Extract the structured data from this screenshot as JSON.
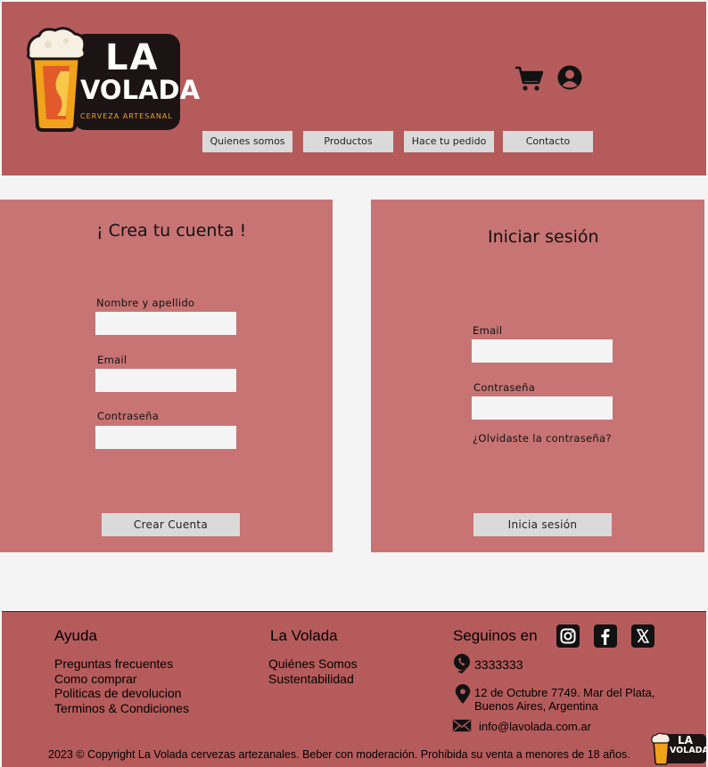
{
  "header": {
    "logo": {
      "line1": "LA",
      "line2": "VOLADA",
      "tagline": "CERVEZA ARTESANAL"
    },
    "icons": [
      "cart-icon",
      "user-icon"
    ],
    "nav": [
      {
        "label": "Quienes somos"
      },
      {
        "label": "Productos"
      },
      {
        "label": "Hace tu pedido"
      },
      {
        "label": "Contacto"
      }
    ]
  },
  "register": {
    "title": "¡ Crea tu cuenta !",
    "name_label": "Nombre y apellido",
    "name_value": "",
    "email_label": "Email",
    "email_value": "",
    "password_label": "Contraseña",
    "password_value": "",
    "submit_label": "Crear Cuenta"
  },
  "login": {
    "title": "Iniciar sesión",
    "email_label": "Email",
    "email_value": "",
    "password_label": "Contraseña",
    "password_value": "",
    "forgot_label": "¿Olvidaste la contraseña?",
    "submit_label": "Inicia sesión"
  },
  "footer": {
    "help": {
      "heading": "Ayuda",
      "links": [
        "Preguntas frecuentes",
        "Como comprar",
        "Politicas de devolucion",
        "Terminos & Condiciones"
      ]
    },
    "about": {
      "heading": "La Volada",
      "links": [
        "Quiénes Somos",
        "Sustentabilidad"
      ]
    },
    "contact": {
      "heading": "Seguinos en",
      "social": [
        "instagram-icon",
        "facebook-icon",
        "x-icon"
      ],
      "phone": "3333333",
      "address": "12 de Octubre 7749. Mar del Plata, Buenos Aires, Argentina",
      "email": "info@lavolada.com.ar"
    },
    "copyright": "2023 © Copyright La Volada cervezas artezanales. Beber con moderación. Prohibida su venta a menores de 18 años.",
    "mini_logo": {
      "line1": "LA",
      "line2": "VOLADA"
    }
  },
  "colors": {
    "header_bg": "#b65b5b",
    "panel_bg": "#c87474",
    "button_bg": "#dadada",
    "page_bg": "#f4f4f4",
    "logo_accent": "#f0a21a"
  }
}
